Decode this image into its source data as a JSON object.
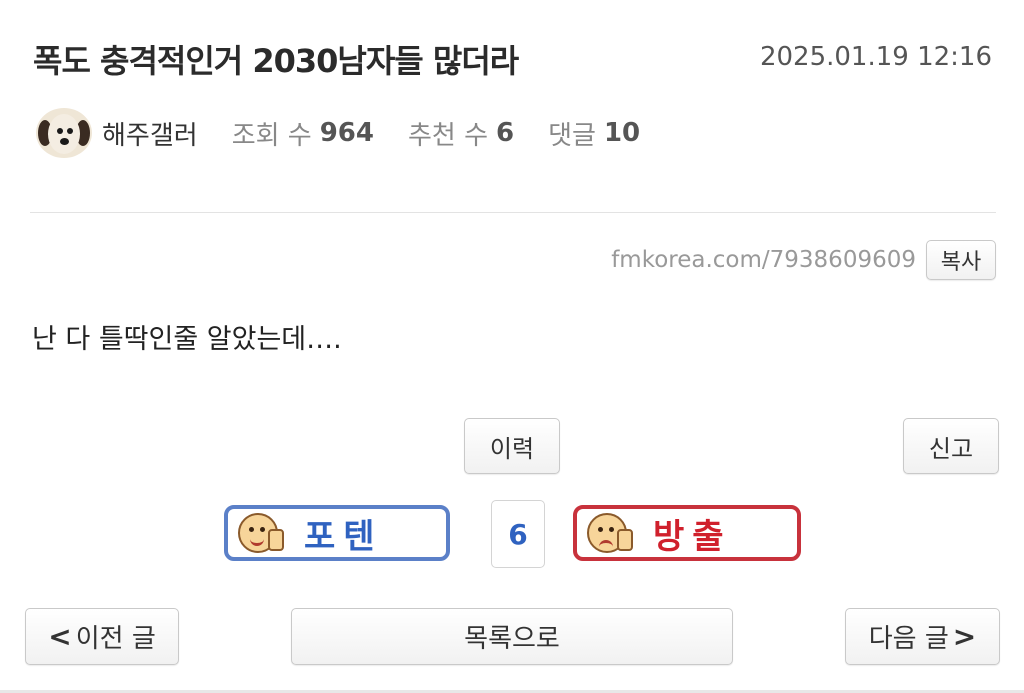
{
  "post": {
    "title": "폭도 충격적인거 2030남자들 많더라",
    "date": "2025.01.19 12:16",
    "author": "해주갤러",
    "views_label": "조회 수",
    "views": "964",
    "recommend_label": "추천 수",
    "recommend": "6",
    "comments_label": "댓글",
    "comments": "10",
    "url": "fmkorea.com/7938609609",
    "copy_label": "복사",
    "body": "난 다 틀딱인줄 알았는데….",
    "colors": {
      "upvote": "#2f62c0",
      "downvote": "#d0202c"
    }
  },
  "actions": {
    "history_label": "이력",
    "report_label": "신고",
    "upvote_label": "포텐",
    "upvote_icon": "thumbs-up-smiley-icon",
    "vote_count": "6",
    "downvote_label": "방출",
    "downvote_icon": "thumbs-down-smiley-icon"
  },
  "nav": {
    "prev_label": "이전 글",
    "prev_icon": "chevron-left-icon",
    "list_label": "목록으로",
    "next_label": "다음 글",
    "next_icon": "chevron-right-icon"
  }
}
